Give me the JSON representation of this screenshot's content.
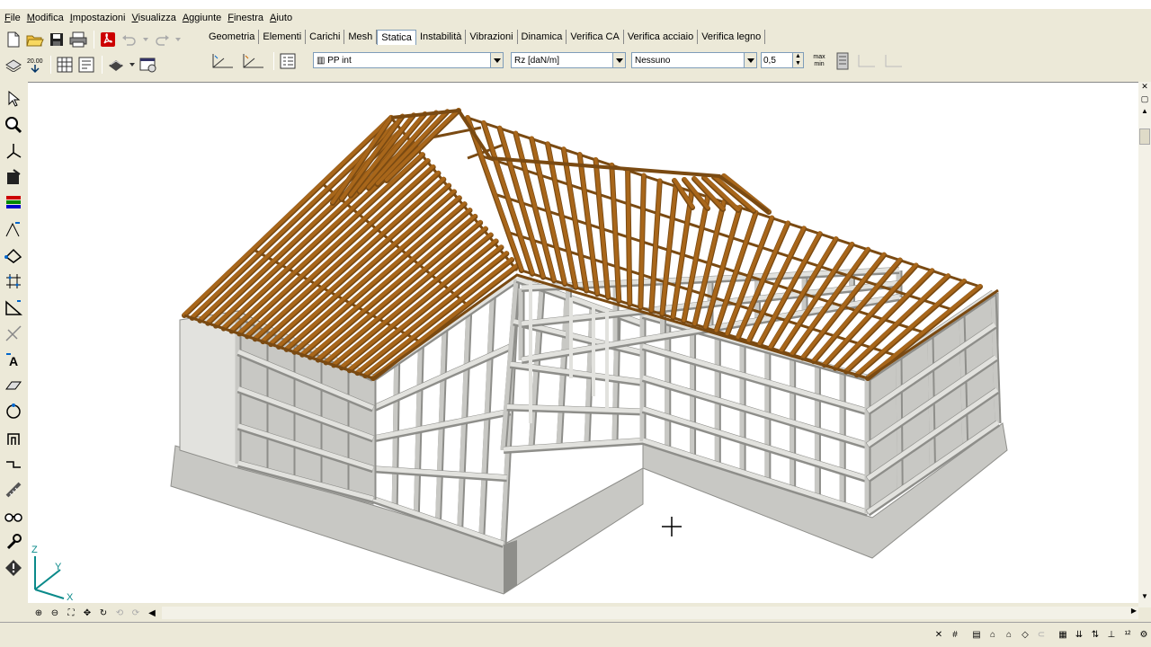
{
  "menu": [
    "File",
    "Modifica",
    "Impostazioni",
    "Visualizza",
    "Aggiunte",
    "Finestra",
    "Aiuto"
  ],
  "tabs": [
    "Geometria",
    "Elementi",
    "Carichi",
    "Mesh",
    "Statica",
    "Instabilità",
    "Vibrazioni",
    "Dinamica",
    "Verifica CA",
    "Verifica acciaio",
    "Verifica legno"
  ],
  "active_tab": "Statica",
  "toolbar": {
    "load_combo": "PP int",
    "result_combo": "Rz [daN/m]",
    "display_combo": "Nessuno",
    "scale_value": "0,5",
    "scale_icon_label": "20.00",
    "max_label": "max",
    "min_label": "min"
  },
  "axes": {
    "x": "X",
    "y": "Y",
    "z": "Z"
  },
  "colors": {
    "timber": "#a8661a",
    "timber_dark": "#7a4a12",
    "concrete": "#c8c8c4",
    "concrete_dark": "#8e8e8a",
    "concrete_light": "#e2e2de",
    "accent": "#0a8a8a"
  }
}
